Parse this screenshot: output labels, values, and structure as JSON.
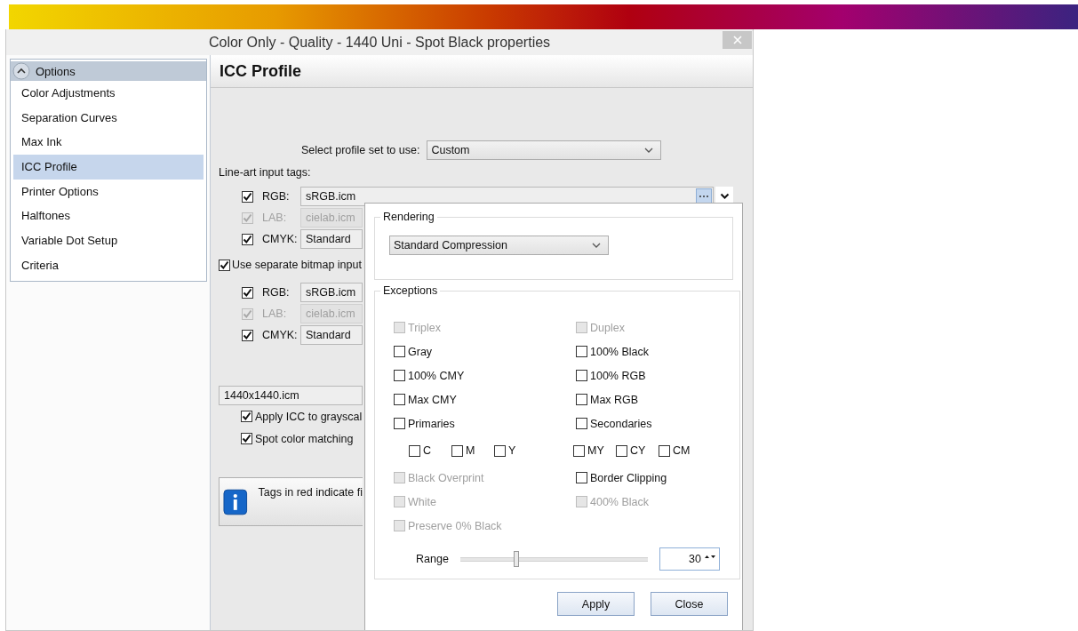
{
  "window": {
    "title": "Color Only - Quality - 1440 Uni - Spot Black properties"
  },
  "sidebar": {
    "header": "Options",
    "items": [
      {
        "label": "Color Adjustments",
        "selected": false
      },
      {
        "label": "Separation Curves",
        "selected": false
      },
      {
        "label": "Max Ink",
        "selected": false
      },
      {
        "label": "ICC Profile",
        "selected": true
      },
      {
        "label": "Printer Options",
        "selected": false
      },
      {
        "label": "Halftones",
        "selected": false
      },
      {
        "label": "Variable Dot Setup",
        "selected": false
      },
      {
        "label": "Criteria",
        "selected": false
      }
    ]
  },
  "panel": {
    "title": "ICC Profile",
    "profile_set": {
      "label": "Select profile set to use:",
      "value": "Custom"
    },
    "line_art": {
      "label": "Line-art input tags:",
      "tags": [
        {
          "label": "RGB:",
          "value": "sRGB.icm",
          "checked": true,
          "disabled": false
        },
        {
          "label": "LAB:",
          "value": "cielab.icm",
          "checked": true,
          "disabled": true
        },
        {
          "label": "CMYK:",
          "value": "Standard",
          "checked": true,
          "disabled": false
        }
      ]
    },
    "bitmap": {
      "label": "Use separate bitmap input",
      "checked": true,
      "tags": [
        {
          "label": "RGB:",
          "value": "sRGB.icm",
          "checked": true,
          "disabled": false
        },
        {
          "label": "LAB:",
          "value": "cielab.icm",
          "checked": true,
          "disabled": true
        },
        {
          "label": "CMYK:",
          "value": "Standard",
          "checked": true,
          "disabled": false
        }
      ]
    },
    "output_profile": "1440x1440.icm",
    "options": [
      {
        "label": "Apply ICC to grayscal",
        "checked": true
      },
      {
        "label": "Spot color matching",
        "checked": true
      }
    ],
    "info": "Tags in red indicate fi"
  },
  "popup": {
    "rendering": {
      "title": "Rendering",
      "value": "Standard Compression"
    },
    "exceptions": {
      "title": "Exceptions",
      "rows": [
        {
          "kind": "pair",
          "left": {
            "label": "Triplex",
            "checked": false,
            "disabled": true
          },
          "right": {
            "label": "Duplex",
            "checked": false,
            "disabled": true
          }
        },
        {
          "kind": "pair",
          "left": {
            "label": "Gray",
            "checked": false,
            "disabled": false
          },
          "right": {
            "label": "100% Black",
            "checked": false,
            "disabled": false
          }
        },
        {
          "kind": "pair",
          "left": {
            "label": "100% CMY",
            "checked": false,
            "disabled": false
          },
          "right": {
            "label": "100% RGB",
            "checked": false,
            "disabled": false
          }
        },
        {
          "kind": "pair",
          "left": {
            "label": "Max CMY",
            "checked": false,
            "disabled": false
          },
          "right": {
            "label": "Max RGB",
            "checked": false,
            "disabled": false
          }
        },
        {
          "kind": "pair",
          "left": {
            "label": "Primaries",
            "checked": false,
            "disabled": false
          },
          "right": {
            "label": "Secondaries",
            "checked": false,
            "disabled": false
          }
        },
        {
          "kind": "sub",
          "left": [
            {
              "label": "C",
              "checked": false
            },
            {
              "label": "M",
              "checked": false
            },
            {
              "label": "Y",
              "checked": false
            }
          ],
          "right": [
            {
              "label": "MY",
              "checked": false
            },
            {
              "label": "CY",
              "checked": false
            },
            {
              "label": "CM",
              "checked": false
            }
          ]
        },
        {
          "kind": "pair",
          "left": {
            "label": "Black Overprint",
            "checked": false,
            "disabled": true
          },
          "right": {
            "label": "Border Clipping",
            "checked": false,
            "disabled": false
          }
        },
        {
          "kind": "pair",
          "left": {
            "label": "White",
            "checked": false,
            "disabled": true
          },
          "right": {
            "label": "400% Black",
            "checked": false,
            "disabled": true
          }
        },
        {
          "kind": "pair",
          "left": {
            "label": "Preserve 0% Black",
            "checked": false,
            "disabled": true
          }
        }
      ]
    },
    "range": {
      "label": "Range",
      "level": 0.3,
      "value": "30"
    },
    "buttons": [
      "Apply",
      "Close"
    ]
  }
}
